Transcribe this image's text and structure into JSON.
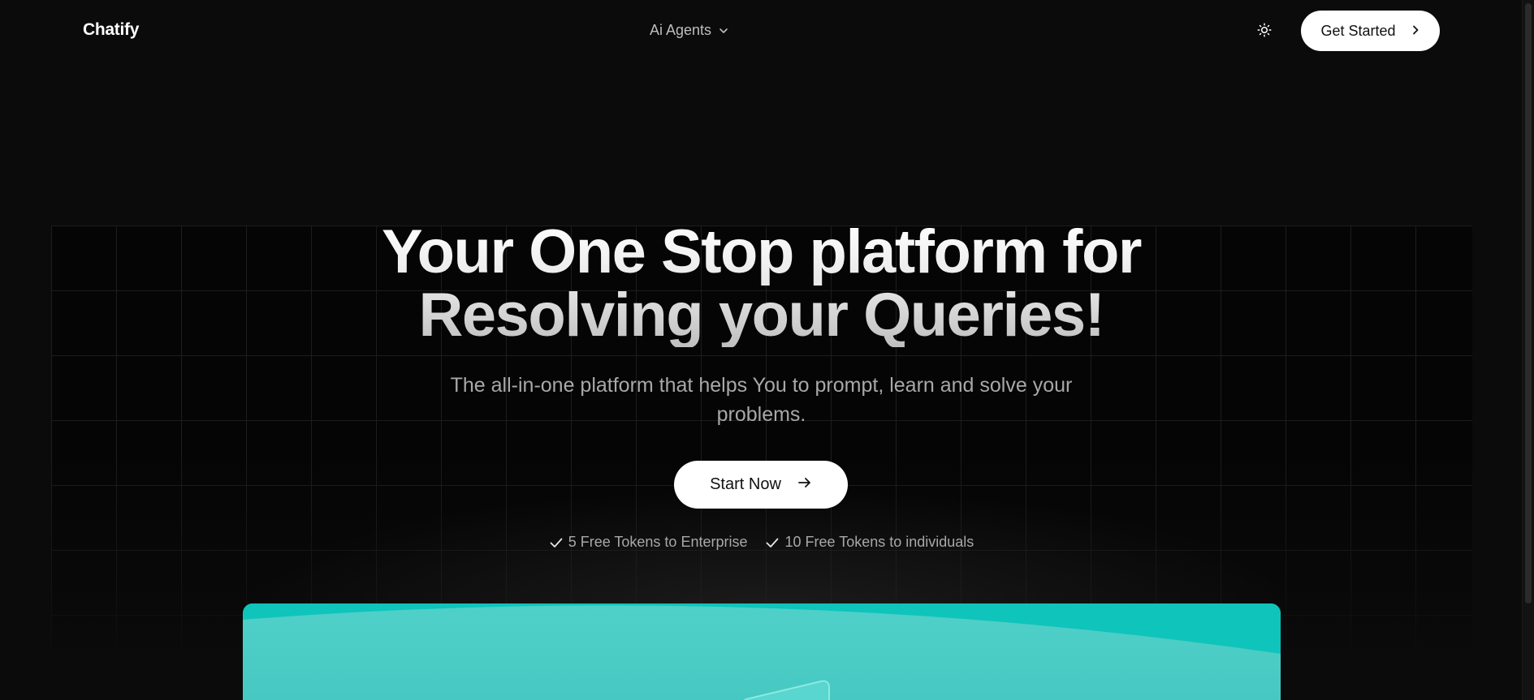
{
  "header": {
    "logo": "Chatify",
    "menu_label": "Ai Agents",
    "get_started_label": "Get Started"
  },
  "hero": {
    "title_line1": "Your One Stop platform for",
    "title_line2": "Resolving your Queries!",
    "subtitle": "The all-in-one platform that helps You to prompt, learn and solve your problems.",
    "cta_label": "Start Now",
    "perks": [
      {
        "label": "5 Free Tokens to Enterprise"
      },
      {
        "label": "10 Free Tokens to individuals"
      }
    ]
  },
  "icons": {
    "menu_chevron": "chevron-down-icon",
    "theme": "sun-icon",
    "get_started": "chevron-right-icon",
    "cta": "arrow-right-icon",
    "perk": "check-icon"
  },
  "colors": {
    "background": "#0b0b0b",
    "button_bg": "#ffffff",
    "preview_accent": "#11c3bb"
  }
}
